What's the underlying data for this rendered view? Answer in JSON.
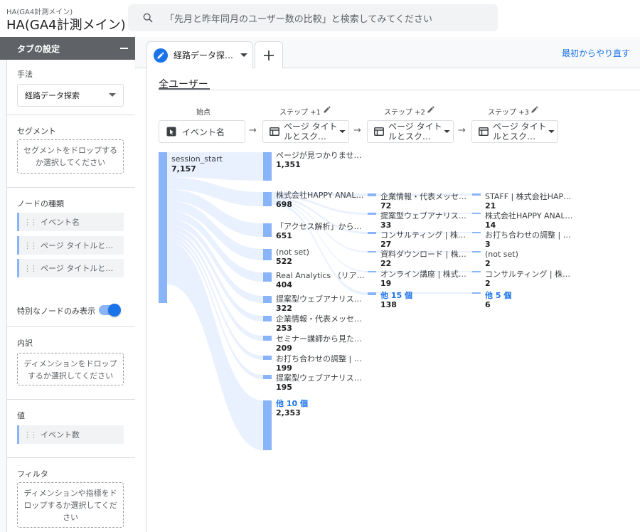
{
  "header": {
    "property_sub": "HA(GA4計測メイン)",
    "property_title": "HA(GA4計測メイン)",
    "search_placeholder": "「先月と昨年同月のユーザー数の比較」と検索してみてください"
  },
  "left_panel": {
    "title": "タブの設定",
    "technique": {
      "label": "手法",
      "value": "経路データ探索"
    },
    "segment": {
      "label": "セグメント",
      "drop_text": "セグメントをドロップするか選択してください"
    },
    "node_types": {
      "label": "ノードの種類",
      "items": [
        "イベント名",
        "ページ タイトルと…",
        "ページ タイトルと…"
      ]
    },
    "special_toggle": {
      "label": "特別なノードのみ表示",
      "on": true
    },
    "breakdown": {
      "label": "内訳",
      "drop_text": "ディメンションをドロップするか選択してください"
    },
    "value": {
      "label": "値",
      "item": "イベント数"
    },
    "filter": {
      "label": "フィルタ",
      "drop_text": "ディメンションや指標をドロップするか選択してください"
    }
  },
  "tabs": {
    "active_label": "経路データ探…",
    "restart_label": "最初からやり直す"
  },
  "segment_title": "全ユーザー",
  "steps": [
    {
      "label": "始点",
      "node": "イベント名"
    },
    {
      "label": "ステップ +1",
      "node": "ページ タイトルとスク…"
    },
    {
      "label": "ステップ +2",
      "node": "ページ タイトルとスク…"
    },
    {
      "label": "ステップ +3",
      "node": "ページ タイトルとスク…"
    }
  ],
  "start_node": {
    "label": "session_start",
    "value": "7,157"
  },
  "step1": [
    {
      "label": "ページが見つかりませ…",
      "value": "1,351"
    },
    {
      "label": "株式会社HAPPY ANAL…",
      "value": "698"
    },
    {
      "label": "「アクセス解析」から…",
      "value": "651"
    },
    {
      "label": "(not set)",
      "value": "522"
    },
    {
      "label": "Real Analytics （リア…",
      "value": "404"
    },
    {
      "label": "提案型ウェブアナリス…",
      "value": "322"
    },
    {
      "label": "企業情報・代表メッセ…",
      "value": "253"
    },
    {
      "label": "セミナー講師から見た…",
      "value": "209"
    },
    {
      "label": "お打ち合わせの調整 | …",
      "value": "199"
    },
    {
      "label": "提案型ウェブアナリス…",
      "value": "195"
    },
    {
      "label": "他 10 個",
      "value": "2,353"
    }
  ],
  "step2": [
    {
      "label": "企業情報・代表メッセ…",
      "value": "72"
    },
    {
      "label": "提案型ウェブアナリス…",
      "value": "33"
    },
    {
      "label": "コンサルティング | 株…",
      "value": "27"
    },
    {
      "label": "資料ダウンロード | 株…",
      "value": "22"
    },
    {
      "label": "オンライン講座 | 株式…",
      "value": "19"
    },
    {
      "label": "他 15 個",
      "value": "138"
    }
  ],
  "step3": [
    {
      "label": "STAFF | 株式会社HAP…",
      "value": "21"
    },
    {
      "label": "株式会社HAPPY ANAL…",
      "value": "14"
    },
    {
      "label": "お打ち合わせの調整 | …",
      "value": "3"
    },
    {
      "label": "(not set)",
      "value": "2"
    },
    {
      "label": "コンサルティング | 株…",
      "value": "2"
    },
    {
      "label": "他 5 個",
      "value": "6"
    }
  ],
  "colors": {
    "accent": "#1a73e8",
    "node_bar": "#8ab4f8",
    "flow": "#e8f0fe"
  }
}
